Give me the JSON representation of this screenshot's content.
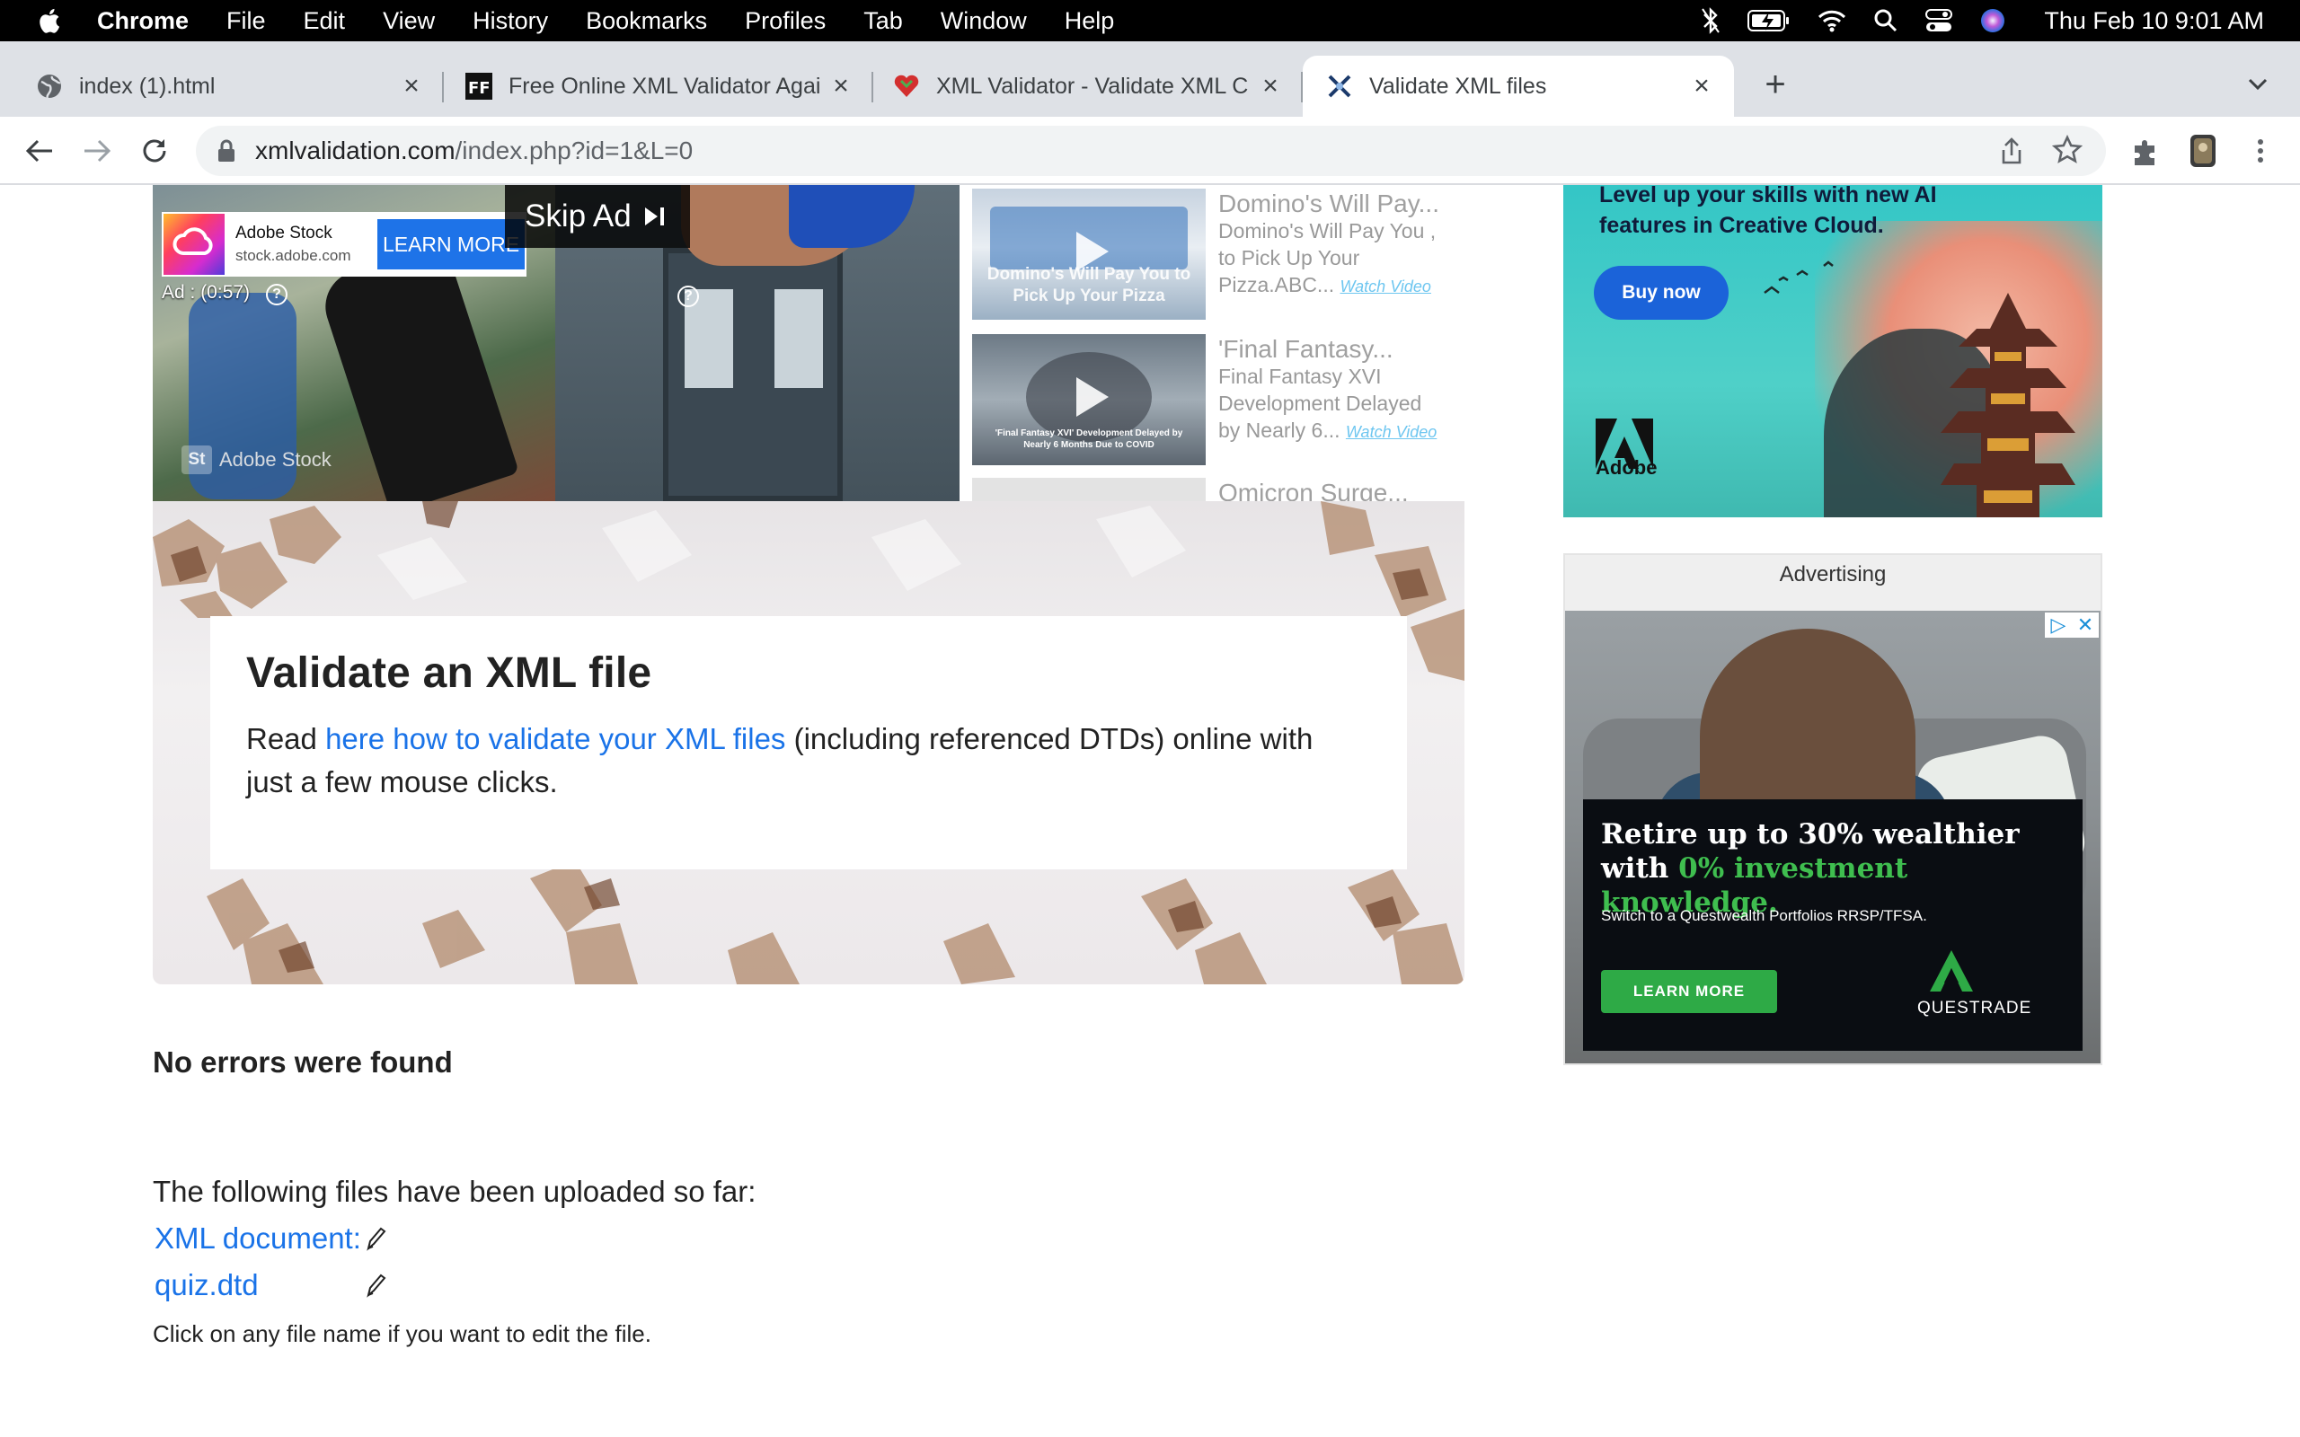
{
  "menubar": {
    "app_name": "Chrome",
    "items": [
      "File",
      "Edit",
      "View",
      "History",
      "Bookmarks",
      "Profiles",
      "Tab",
      "Window",
      "Help"
    ],
    "clock": "Thu Feb 10  9:01 AM",
    "status_icons": [
      "bluetooth-icon",
      "battery-charging-icon",
      "wifi-icon",
      "spotlight-search-icon",
      "control-center-icon",
      "siri-icon"
    ]
  },
  "tabs": [
    {
      "title": "index (1).html",
      "favicon": "globe-icon",
      "active": false
    },
    {
      "title": "Free Online XML Validator Agai",
      "favicon": "ff-icon",
      "active": false
    },
    {
      "title": "XML Validator - Validate XML C",
      "favicon": "heart-icon",
      "active": false
    },
    {
      "title": "Validate XML files",
      "favicon": "xml-tools-icon",
      "active": true
    }
  ],
  "omnibox": {
    "host": "xmlvalidation.com",
    "path": "/index.php?id=1&L=0"
  },
  "video_ad": {
    "advertiser": "Adobe Stock",
    "domain": "stock.adobe.com",
    "cta": "LEARN MORE",
    "skip_label": "Skip Ad",
    "timer": "Ad : (0:57)",
    "watermark": "Adobe Stock",
    "watermark_badge": "St"
  },
  "related_videos": [
    {
      "title": "Domino's Will Pay...",
      "lines": [
        "Domino's Will Pay You ,",
        "to Pick Up Your",
        "Pizza.ABC..."
      ],
      "watch": "Watch Video",
      "thumb_caption": "Domino's Will Pay You to Pick Up Your Pizza"
    },
    {
      "title": "'Final Fantasy...",
      "lines": [
        "Final Fantasy XVI",
        "Development Delayed",
        "by Nearly 6..."
      ],
      "watch": "Watch Video",
      "thumb_caption": "'Final Fantasy XVI' Development Delayed by Nearly 6 Months Due to COVID"
    },
    {
      "title": "Omicron Surge...",
      "lines": [],
      "watch": "",
      "thumb_caption": ""
    }
  ],
  "hero": {
    "heading": "Validate an XML file",
    "text_before": "Read ",
    "link": "here how to validate your XML files",
    "text_after": " (including referenced DTDs) online with just a few mouse clicks."
  },
  "result": {
    "status": "No errors were found",
    "uploads_intro": "The following files have been uploaded so far:",
    "files": [
      "XML document:",
      "quiz.dtd"
    ],
    "hint": "Click on any file name if you want to edit the file."
  },
  "ad_adobe": {
    "headline": "Level up your skills with new AI features in Creative Cloud.",
    "cta": "Buy now",
    "brand": "Adobe"
  },
  "ad_questrade": {
    "label": "Advertising",
    "headline_part1": "Retire up to 30% wealthier with ",
    "headline_green": "0% investment knowledge.",
    "sub": "Switch to a Questwealth Portfolios RRSP/TFSA.",
    "cta": "LEARN MORE",
    "brand": "QUESTRADE"
  },
  "colors": {
    "link": "#1a73e8",
    "menubar_bg": "#000000",
    "tabstrip_bg": "#dee1e6",
    "questrade_green": "#2eaa46"
  }
}
